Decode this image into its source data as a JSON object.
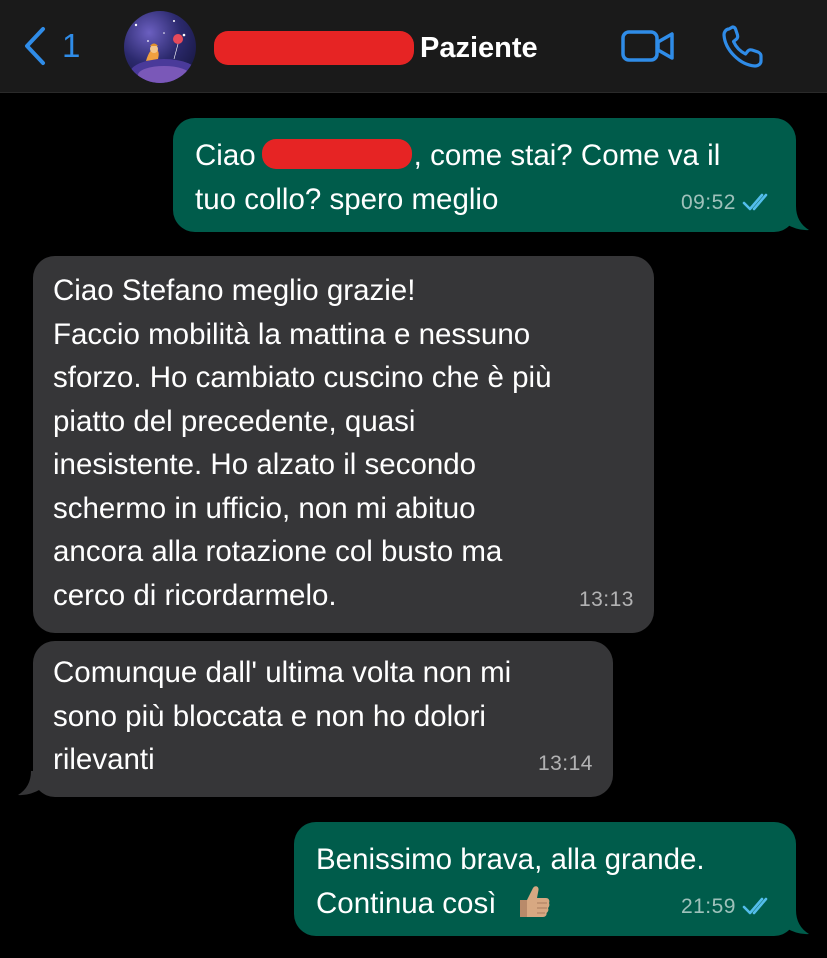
{
  "header": {
    "back_count": "1",
    "contact_name_visible": "Paziente",
    "colors": {
      "accent": "#2f8ce8",
      "header_bg": "#1a1a1a"
    },
    "icons": [
      "chevron-left-icon",
      "video-camera-icon",
      "phone-icon"
    ]
  },
  "messages": [
    {
      "direction": "outgoing",
      "lines_before_redaction": "Ciao",
      "lines": [
        ", come stai? Come va il",
        "tuo collo? spero meglio"
      ],
      "time": "09:52",
      "status": "read"
    },
    {
      "direction": "incoming",
      "lines": [
        "Ciao Stefano meglio grazie!",
        "Faccio mobilità la mattina e nessuno",
        "sforzo. Ho cambiato cuscino che è più",
        "piatto del precedente, quasi",
        "inesistente. Ho alzato il secondo",
        "schermo in ufficio, non mi abituo",
        "ancora alla rotazione col busto ma",
        "cerco di ricordarmelo."
      ],
      "time": "13:13"
    },
    {
      "direction": "incoming",
      "lines": [
        "Comunque dall' ultima volta non mi",
        "sono più bloccata e non ho dolori",
        "rilevanti"
      ],
      "time": "13:14"
    },
    {
      "direction": "outgoing",
      "lines": [
        "Benissimo brava, alla grande.",
        "Continua così"
      ],
      "emoji": "thumbs-up-icon",
      "time": "21:59",
      "status": "read"
    }
  ],
  "colors": {
    "outgoing_bubble": "#005c4b",
    "incoming_bubble": "#363638",
    "redaction": "#e62424",
    "read_ticks": "#53bdeb"
  }
}
